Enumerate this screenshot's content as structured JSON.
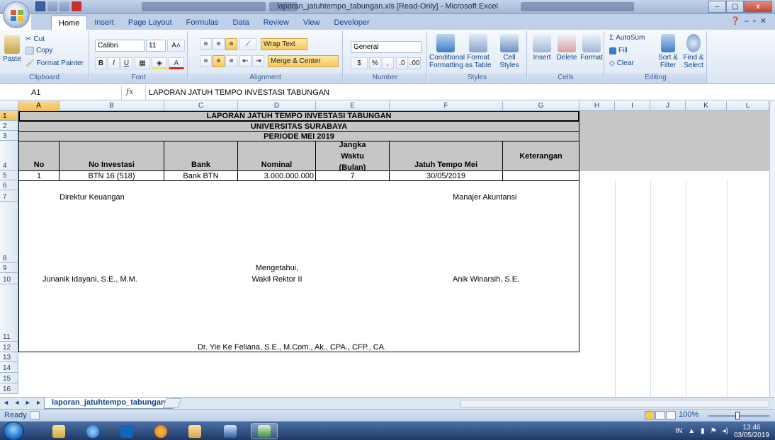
{
  "window": {
    "title": "laporan_jatuhtempo_tabungan.xls  [Read-Only] - Microsoft Excel",
    "controls": [
      "–",
      "▢",
      "x"
    ]
  },
  "ribbon": {
    "tabs": [
      "Home",
      "Insert",
      "Page Layout",
      "Formulas",
      "Data",
      "Review",
      "View",
      "Developer"
    ],
    "active_tab": "Home",
    "clipboard": {
      "label": "Clipboard",
      "paste": "Paste",
      "cut": "Cut",
      "copy": "Copy",
      "format_painter": "Format Painter"
    },
    "font": {
      "label": "Font",
      "name": "Calibri",
      "size": "11",
      "bold": "B",
      "italic": "I",
      "underline": "U"
    },
    "alignment": {
      "label": "Alignment",
      "wrap_text": "Wrap Text",
      "merge_center": "Merge & Center"
    },
    "number": {
      "label": "Number",
      "format": "General",
      "percent": "%",
      "comma": ","
    },
    "styles": {
      "label": "Styles",
      "conditional": "Conditional Formatting",
      "format_table": "Format as Table",
      "cell_styles": "Cell Styles"
    },
    "cells": {
      "label": "Cells",
      "insert": "Insert",
      "delete": "Delete",
      "format": "Format"
    },
    "editing": {
      "label": "Editing",
      "autosum": "AutoSum",
      "fill": "Fill",
      "clear": "Clear",
      "sort_filter": "Sort & Filter",
      "find_select": "Find & Select"
    }
  },
  "formula_bar": {
    "name_box": "A1",
    "fx": "fx",
    "content": "LAPORAN JATUH TEMPO INVESTASI TABUNGAN"
  },
  "grid": {
    "columns": [
      "A",
      "B",
      "C",
      "D",
      "E",
      "F",
      "G",
      "H",
      "I",
      "J",
      "K",
      "L"
    ],
    "rows": [
      "1",
      "2",
      "3",
      "4",
      "5",
      "6",
      "7",
      "8",
      "9",
      "10",
      "11",
      "12",
      "13",
      "14",
      "15",
      "16"
    ],
    "title1": "LAPORAN JATUH TEMPO INVESTASI TABUNGAN",
    "title2": "UNIVERSITAS SURABAYA",
    "title3": "PERIODE MEI 2019",
    "headers": {
      "no": "No",
      "no_investasi": "No Investasi",
      "bank": "Bank",
      "nominal": "Nominal",
      "jangka_waktu": "Jangka Waktu (Bulan)",
      "jatuh_tempo": "Jatuh Tempo Mei",
      "keterangan": "Keterangan"
    },
    "row5": {
      "no": "1",
      "no_investasi": "BTN 16 (518)",
      "bank": "Bank BTN",
      "nominal": "3.000.000.000",
      "jangka_waktu": "7",
      "jatuh_tempo": "30/05/2019",
      "keterangan": ""
    },
    "signatures": {
      "direktur_title": "Direktur Keuangan",
      "manajer_title": "Manajer Akuntansi",
      "mengetahui": "Mengetahui,",
      "wakil_rektor": "Wakil Rektor II",
      "direktur_name": "Junanik Idayani, S.E., M.M.",
      "manajer_name": "Anik Winarsih, S.E.",
      "rektor_name": "Dr. Yie Ke Feliana, S.E., M.Com., Ak., CPA., CFP., CA."
    }
  },
  "sheet_tab": "laporan_jatuhtempo_tabungan",
  "status": {
    "ready": "Ready",
    "zoom": "100%"
  },
  "taskbar": {
    "lang": "IN",
    "time": "13:46",
    "date": "03/05/2019"
  }
}
